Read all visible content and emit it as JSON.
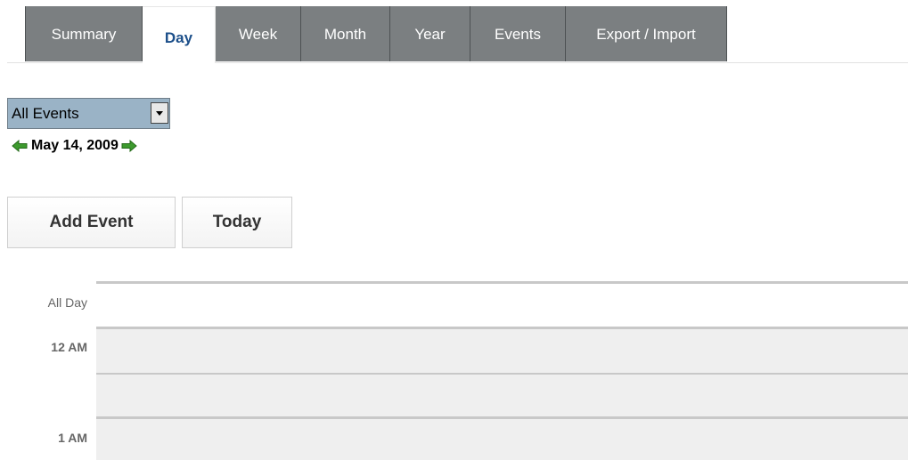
{
  "tabs": [
    {
      "label": "Summary",
      "active": false
    },
    {
      "label": "Day",
      "active": true
    },
    {
      "label": "Week",
      "active": false
    },
    {
      "label": "Month",
      "active": false
    },
    {
      "label": "Year",
      "active": false
    },
    {
      "label": "Events",
      "active": false
    },
    {
      "label": "Export / Import",
      "active": false
    }
  ],
  "filter": {
    "selected": "All Events"
  },
  "date_nav": {
    "date": "May 14, 2009",
    "prev_icon": "green-left-arrow",
    "next_icon": "green-right-arrow"
  },
  "buttons": {
    "add_event": "Add Event",
    "today": "Today"
  },
  "calendar": {
    "all_day_label": "All Day",
    "hours": [
      "12 AM",
      "1 AM"
    ]
  },
  "colors": {
    "tab_bg": "#7b7f81",
    "active_tab_text": "#1c4f8a",
    "select_bg": "#9ab3c6",
    "slot_bg": "#efefef",
    "arrow_green": "#3d9a2e"
  }
}
